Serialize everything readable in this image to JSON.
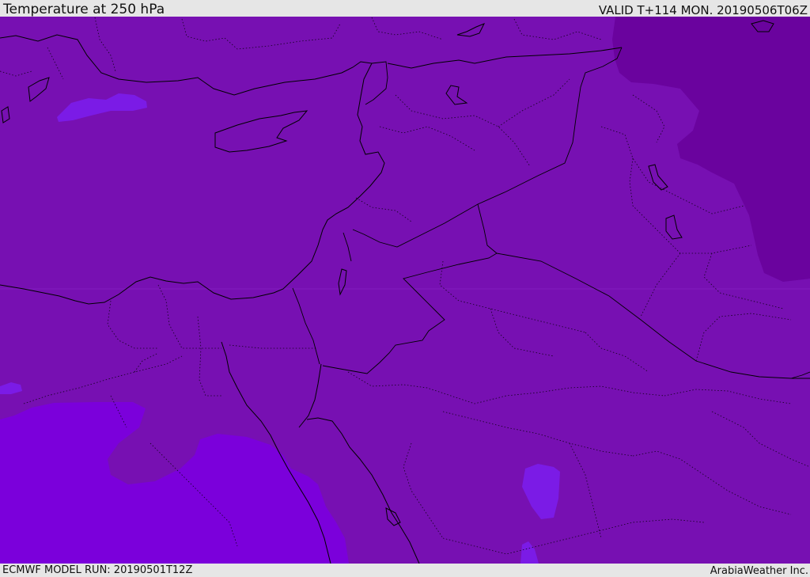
{
  "header": {
    "title": "Temperature at 250 hPa",
    "valid": "VALID T+114 MON. 20190506T06Z"
  },
  "footer": {
    "model_run": "ECMWF MODEL RUN: 20190501T12Z",
    "credit": "ArabiaWeather Inc."
  },
  "map": {
    "region": "Eastern Mediterranean / Middle East",
    "colors": {
      "base_field": "#7710b2",
      "cold_field": "#6a039e",
      "warm_field": "#7b00db",
      "warm_patch": "#7b1be6",
      "coastline": "#000000",
      "boundary": "#000000"
    }
  }
}
